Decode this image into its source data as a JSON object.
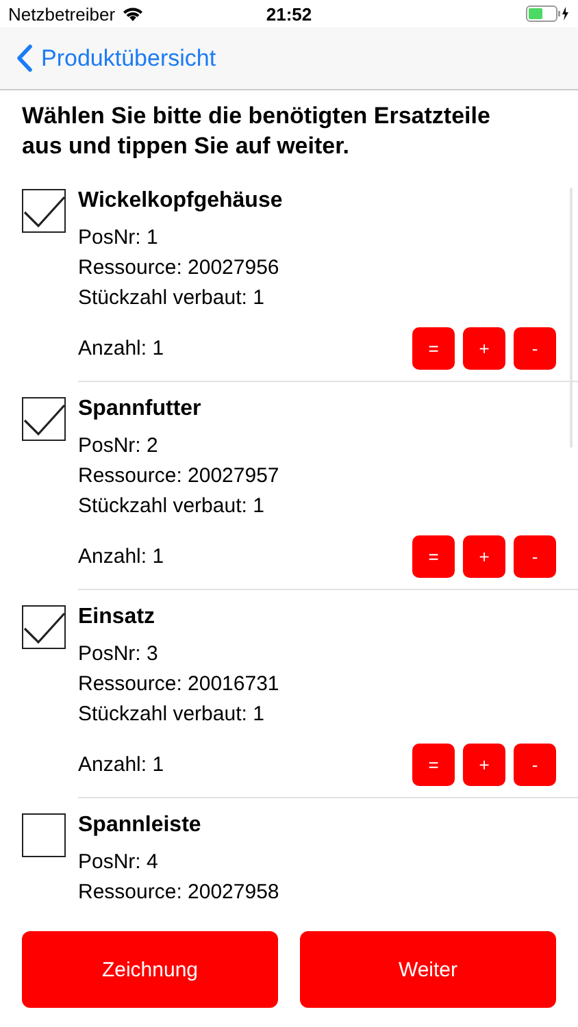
{
  "status_bar": {
    "carrier": "Netzbetreiber",
    "time": "21:52"
  },
  "nav": {
    "back": "Produktübersicht"
  },
  "heading": "Wählen Sie bitte die benötigten Ersatzteile aus und tippen Sie auf weiter.",
  "items": [
    {
      "name": "Wickelkopfgehäuse",
      "checked": true,
      "posnr": "PosNr: 1",
      "ressource": "Ressource: 20027956",
      "stueckzahl": "Stückzahl verbaut: 1",
      "anzahl": "Anzahl: 1",
      "buttons": [
        "=",
        "+",
        "-"
      ]
    },
    {
      "name": "Spannfutter",
      "checked": true,
      "posnr": "PosNr: 2",
      "ressource": "Ressource: 20027957",
      "stueckzahl": "Stückzahl verbaut: 1",
      "anzahl": "Anzahl: 1",
      "buttons": [
        "=",
        "+",
        "-"
      ]
    },
    {
      "name": "Einsatz",
      "checked": true,
      "posnr": "PosNr: 3",
      "ressource": "Ressource: 20016731",
      "stueckzahl": "Stückzahl verbaut: 1",
      "anzahl": "Anzahl: 1",
      "buttons": [
        "=",
        "+",
        "-"
      ]
    },
    {
      "name": "Spannleiste",
      "checked": false,
      "posnr": "PosNr: 4",
      "ressource": "Ressource: 20027958"
    }
  ],
  "footer_buttons": [
    "Zeichnung",
    "Weiter"
  ]
}
